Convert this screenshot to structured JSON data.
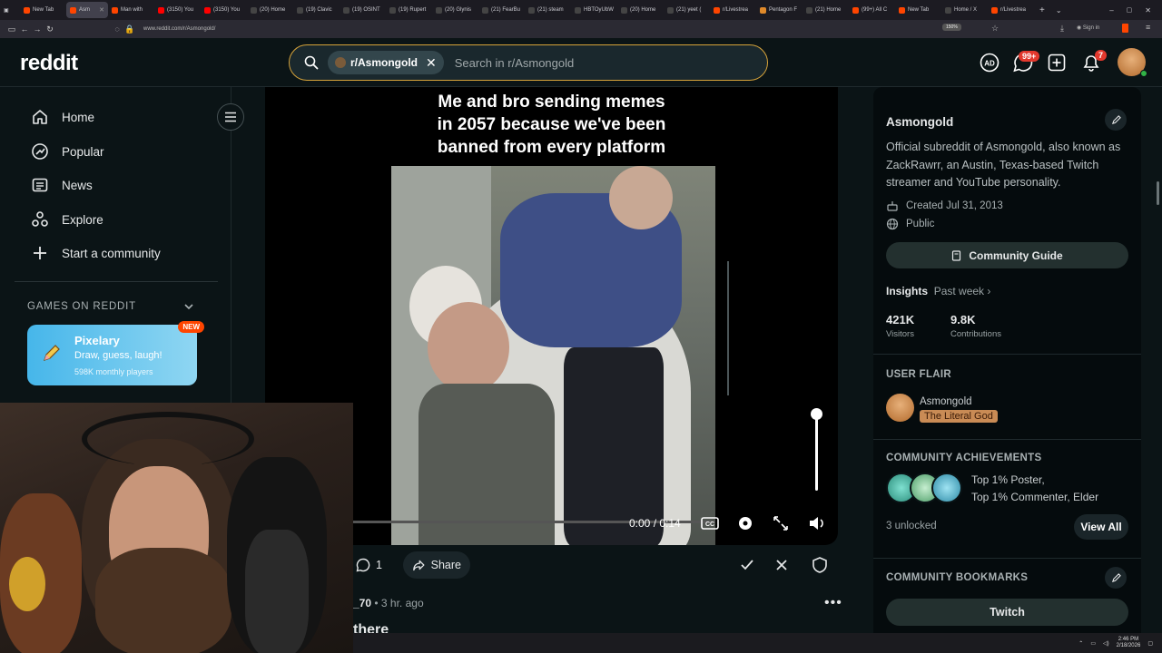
{
  "browser": {
    "tabs": [
      {
        "label": "New Tab",
        "color": "#ff4500"
      },
      {
        "label": "Asm",
        "color": "#ff4500",
        "active": true
      },
      {
        "label": "Man with",
        "color": "#ff4500"
      },
      {
        "label": "(3150) You",
        "color": "#ff0000"
      },
      {
        "label": "(3150) You",
        "color": "#ff0000"
      },
      {
        "label": "(20) Home",
        "color": "#444444"
      },
      {
        "label": "(19) Clavic",
        "color": "#444444"
      },
      {
        "label": "(19) OSINT",
        "color": "#444444"
      },
      {
        "label": "(19) Rupert",
        "color": "#444444"
      },
      {
        "label": "(20) Glynis",
        "color": "#444444"
      },
      {
        "label": "(21) FearBu",
        "color": "#444444"
      },
      {
        "label": "(21) steam",
        "color": "#444444"
      },
      {
        "label": "HBTOyUbW",
        "color": "#444444"
      },
      {
        "label": "(20) Home",
        "color": "#444444"
      },
      {
        "label": "(21) yeet (",
        "color": "#444444"
      },
      {
        "label": "r/Livestrea",
        "color": "#ff4500"
      },
      {
        "label": "Pentagon F",
        "color": "#e08a2a"
      },
      {
        "label": "(21) Home",
        "color": "#444444"
      },
      {
        "label": "(99+) All C",
        "color": "#ff4500"
      },
      {
        "label": "New Tab",
        "color": "#ff4500"
      },
      {
        "label": "Home / X",
        "color": "#444444"
      },
      {
        "label": "r/Livestrea",
        "color": "#ff4500"
      }
    ],
    "url": "www.reddit.com/r/Asmongold/",
    "zoom": "150%",
    "signin": "Sign in"
  },
  "header": {
    "logo": "reddit",
    "chip_label": "r/Asmongold",
    "search_placeholder": "Search in r/Asmongold",
    "chat_badge": "99+",
    "notif_badge": "7"
  },
  "sidebar": {
    "items": [
      {
        "label": "Home",
        "icon": "home-icon"
      },
      {
        "label": "Popular",
        "icon": "popular-icon"
      },
      {
        "label": "News",
        "icon": "news-icon"
      },
      {
        "label": "Explore",
        "icon": "explore-icon"
      },
      {
        "label": "Start a community",
        "icon": "plus-icon"
      }
    ],
    "games_header": "GAMES ON REDDIT",
    "pixelary": {
      "title": "Pixelary",
      "subtitle": "Draw, guess, laugh!",
      "meta": "598K monthly players",
      "badge": "NEW"
    }
  },
  "post": {
    "caption": "Me and bro sending memes in 2057 because we've been banned from every platform",
    "video_time": "0:00 / 0:14",
    "comments": "1",
    "share": "Share",
    "author": "_70",
    "age": "• 3 hr. ago",
    "title_fragment": "there"
  },
  "community": {
    "name": "Asmongold",
    "description": "Official subreddit of Asmongold, also known as ZackRawrr, an Austin, Texas-based Twitch streamer and YouTube personality.",
    "created": "Created Jul 31, 2013",
    "visibility": "Public",
    "guide_label": "Community Guide",
    "insights_label": "Insights",
    "insights_period": "Past week",
    "visitors_value": "421K",
    "visitors_label": "Visitors",
    "contrib_value": "9.8K",
    "contrib_label": "Contributions",
    "flair_header": "USER FLAIR",
    "flair_user": "Asmongold",
    "flair_tag": "The Literal God",
    "achievements_header": "COMMUNITY ACHIEVEMENTS",
    "achievement_1": "Top 1% Poster,",
    "achievement_2": "Top 1% Commenter, Elder",
    "unlocked": "3 unlocked",
    "view_all": "View All",
    "bookmarks_header": "COMMUNITY BOOKMARKS",
    "bookmark_1": "Twitch"
  },
  "taskbar": {
    "time": "2:46 PM",
    "date": "2/18/2026"
  }
}
